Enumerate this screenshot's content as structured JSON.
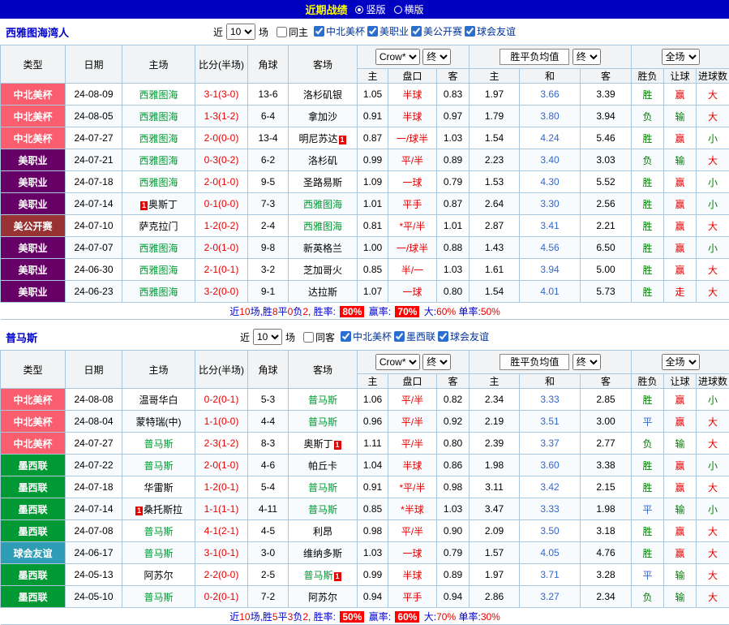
{
  "topbar": {
    "title": "近期战绩",
    "options": [
      {
        "label": "竖版",
        "selected": true
      },
      {
        "label": "横版",
        "selected": false
      }
    ]
  },
  "colors": {
    "topbar_bg": "#0101c1",
    "title_yellow": "#ffff00",
    "team_blue": "#0000cc",
    "green_team": "#009933",
    "score_red": "#e60000",
    "avg_draw_blue": "#3366cc",
    "type_leagues_cup": "#f95d6e",
    "type_mls": "#660066",
    "type_us_open": "#993333",
    "type_liga_mx": "#009933",
    "type_friendly": "#2f9db6"
  },
  "sections": [
    {
      "team": "西雅图海湾人",
      "filter": {
        "near": "近",
        "count": "10",
        "games": "场",
        "same": "同主",
        "leagues": [
          "中北美杯",
          "美职业",
          "美公开赛",
          "球会友谊"
        ]
      },
      "head": {
        "type": "类型",
        "date": "日期",
        "home": "主场",
        "score": "比分(半场)",
        "corner": "角球",
        "away": "客场",
        "odds_select": "Crow*",
        "fin1": "终",
        "avg": "胜平负均值",
        "fin2": "终",
        "scope": "全场",
        "sub": [
          "主",
          "盘口",
          "客",
          "主",
          "和",
          "客",
          "胜负",
          "让球",
          "进球数"
        ]
      },
      "rows": [
        {
          "type": "中北美杯",
          "tc": "cnc",
          "date": "24-08-09",
          "home": {
            "n": "西雅图海",
            "g": true,
            "b": ""
          },
          "score": "3-1(3-0)",
          "corner": "13-6",
          "away": {
            "n": "洛杉矶银",
            "g": false,
            "b": ""
          },
          "o1": "1.05",
          "pan": "半球",
          "o2": "0.83",
          "a1": "1.97",
          "a2": "3.66",
          "a3": "3.39",
          "r1": {
            "t": "胜",
            "c": "g"
          },
          "r2": {
            "t": "赢",
            "c": "r"
          },
          "r3": {
            "t": "大",
            "c": "r"
          }
        },
        {
          "type": "中北美杯",
          "tc": "cnc",
          "date": "24-08-05",
          "home": {
            "n": "西雅图海",
            "g": true,
            "b": ""
          },
          "score": "1-3(1-2)",
          "corner": "6-4",
          "away": {
            "n": "拿加沙",
            "g": false,
            "b": ""
          },
          "o1": "0.91",
          "pan": "半球",
          "o2": "0.97",
          "a1": "1.79",
          "a2": "3.80",
          "a3": "3.94",
          "r1": {
            "t": "负",
            "c": "g"
          },
          "r2": {
            "t": "输",
            "c": "g"
          },
          "r3": {
            "t": "大",
            "c": "r"
          }
        },
        {
          "type": "中北美杯",
          "tc": "cnc",
          "date": "24-07-27",
          "home": {
            "n": "西雅图海",
            "g": true,
            "b": ""
          },
          "score": "2-0(0-0)",
          "corner": "13-4",
          "away": {
            "n": "明尼苏达",
            "g": false,
            "b": "after"
          },
          "o1": "0.87",
          "pan": "一/球半",
          "o2": "1.03",
          "a1": "1.54",
          "a2": "4.24",
          "a3": "5.46",
          "r1": {
            "t": "胜",
            "c": "g"
          },
          "r2": {
            "t": "赢",
            "c": "r"
          },
          "r3": {
            "t": "小",
            "c": "g"
          }
        },
        {
          "type": "美职业",
          "tc": "mls",
          "date": "24-07-21",
          "home": {
            "n": "西雅图海",
            "g": true,
            "b": ""
          },
          "score": "0-3(0-2)",
          "corner": "6-2",
          "away": {
            "n": "洛杉矶",
            "g": false,
            "b": ""
          },
          "o1": "0.99",
          "pan": "平/半",
          "o2": "0.89",
          "a1": "2.23",
          "a2": "3.40",
          "a3": "3.03",
          "r1": {
            "t": "负",
            "c": "g"
          },
          "r2": {
            "t": "输",
            "c": "g"
          },
          "r3": {
            "t": "大",
            "c": "r"
          }
        },
        {
          "type": "美职业",
          "tc": "mls",
          "date": "24-07-18",
          "home": {
            "n": "西雅图海",
            "g": true,
            "b": ""
          },
          "score": "2-0(1-0)",
          "corner": "9-5",
          "away": {
            "n": "圣路易斯",
            "g": false,
            "b": ""
          },
          "o1": "1.09",
          "pan": "一球",
          "o2": "0.79",
          "a1": "1.53",
          "a2": "4.30",
          "a3": "5.52",
          "r1": {
            "t": "胜",
            "c": "g"
          },
          "r2": {
            "t": "赢",
            "c": "r"
          },
          "r3": {
            "t": "小",
            "c": "g"
          }
        },
        {
          "type": "美职业",
          "tc": "mls",
          "date": "24-07-14",
          "home": {
            "n": "奥斯丁",
            "g": false,
            "b": "before"
          },
          "score": "0-1(0-0)",
          "corner": "7-3",
          "away": {
            "n": "西雅图海",
            "g": true,
            "b": ""
          },
          "o1": "1.01",
          "pan": "平手",
          "o2": "0.87",
          "a1": "2.64",
          "a2": "3.30",
          "a3": "2.56",
          "r1": {
            "t": "胜",
            "c": "g"
          },
          "r2": {
            "t": "赢",
            "c": "r"
          },
          "r3": {
            "t": "小",
            "c": "g"
          }
        },
        {
          "type": "美公开赛",
          "tc": "open",
          "date": "24-07-10",
          "home": {
            "n": "萨克拉门",
            "g": false,
            "b": ""
          },
          "score": "1-2(0-2)",
          "corner": "2-4",
          "away": {
            "n": "西雅图海",
            "g": true,
            "b": ""
          },
          "o1": "0.81",
          "pan": "*平/半",
          "o2": "1.01",
          "a1": "2.87",
          "a2": "3.41",
          "a3": "2.21",
          "r1": {
            "t": "胜",
            "c": "g"
          },
          "r2": {
            "t": "赢",
            "c": "r"
          },
          "r3": {
            "t": "大",
            "c": "r"
          }
        },
        {
          "type": "美职业",
          "tc": "mls",
          "date": "24-07-07",
          "home": {
            "n": "西雅图海",
            "g": true,
            "b": ""
          },
          "score": "2-0(1-0)",
          "corner": "9-8",
          "away": {
            "n": "新英格兰",
            "g": false,
            "b": ""
          },
          "o1": "1.00",
          "pan": "一/球半",
          "o2": "0.88",
          "a1": "1.43",
          "a2": "4.56",
          "a3": "6.50",
          "r1": {
            "t": "胜",
            "c": "g"
          },
          "r2": {
            "t": "赢",
            "c": "r"
          },
          "r3": {
            "t": "小",
            "c": "g"
          }
        },
        {
          "type": "美职业",
          "tc": "mls",
          "date": "24-06-30",
          "home": {
            "n": "西雅图海",
            "g": true,
            "b": ""
          },
          "score": "2-1(0-1)",
          "corner": "3-2",
          "away": {
            "n": "芝加哥火",
            "g": false,
            "b": ""
          },
          "o1": "0.85",
          "pan": "半/一",
          "o2": "1.03",
          "a1": "1.61",
          "a2": "3.94",
          "a3": "5.00",
          "r1": {
            "t": "胜",
            "c": "g"
          },
          "r2": {
            "t": "赢",
            "c": "r"
          },
          "r3": {
            "t": "大",
            "c": "r"
          }
        },
        {
          "type": "美职业",
          "tc": "mls",
          "date": "24-06-23",
          "home": {
            "n": "西雅图海",
            "g": true,
            "b": ""
          },
          "score": "3-2(0-0)",
          "corner": "9-1",
          "away": {
            "n": "达拉斯",
            "g": false,
            "b": ""
          },
          "o1": "1.07",
          "pan": "一球",
          "o2": "0.80",
          "a1": "1.54",
          "a2": "4.01",
          "a3": "5.73",
          "r1": {
            "t": "胜",
            "c": "g"
          },
          "r2": {
            "t": "走",
            "c": "r"
          },
          "r3": {
            "t": "大",
            "c": "r"
          }
        }
      ],
      "footer": {
        "parts": [
          {
            "t": "近",
            "c": "fb"
          },
          {
            "t": "10",
            "c": "fr"
          },
          {
            "t": "场,胜",
            "c": "fb"
          },
          {
            "t": "8",
            "c": "fr"
          },
          {
            "t": "平",
            "c": "fb"
          },
          {
            "t": "0",
            "c": "fr"
          },
          {
            "t": "负",
            "c": "fb"
          },
          {
            "t": "2",
            "c": "fr"
          },
          {
            "t": ", 胜率: ",
            "c": "fb"
          },
          {
            "t": "80%",
            "c": "pct"
          },
          {
            "t": " 赢率: ",
            "c": "fb"
          },
          {
            "t": "70%",
            "c": "pct"
          },
          {
            "t": " 大:",
            "c": "fb"
          },
          {
            "t": "60%",
            "c": "fr"
          },
          {
            "t": " 单率:",
            "c": "fb"
          },
          {
            "t": "50%",
            "c": "fr"
          }
        ]
      }
    },
    {
      "team": "普马斯",
      "filter": {
        "near": "近",
        "count": "10",
        "games": "场",
        "same": "同客",
        "leagues": [
          "中北美杯",
          "墨西联",
          "球会友谊"
        ]
      },
      "head": {
        "type": "类型",
        "date": "日期",
        "home": "主场",
        "score": "比分(半场)",
        "corner": "角球",
        "away": "客场",
        "odds_select": "Crow*",
        "fin1": "终",
        "avg": "胜平负均值",
        "fin2": "终",
        "scope": "全场",
        "sub": [
          "主",
          "盘口",
          "客",
          "主",
          "和",
          "客",
          "胜负",
          "让球",
          "进球数"
        ]
      },
      "rows": [
        {
          "type": "中北美杯",
          "tc": "cnc",
          "date": "24-08-08",
          "home": {
            "n": "温哥华白",
            "g": false,
            "b": ""
          },
          "score": "0-2(0-1)",
          "corner": "5-3",
          "away": {
            "n": "普马斯",
            "g": true,
            "b": ""
          },
          "o1": "1.06",
          "pan": "平/半",
          "o2": "0.82",
          "a1": "2.34",
          "a2": "3.33",
          "a3": "2.85",
          "r1": {
            "t": "胜",
            "c": "g"
          },
          "r2": {
            "t": "赢",
            "c": "r"
          },
          "r3": {
            "t": "小",
            "c": "g"
          }
        },
        {
          "type": "中北美杯",
          "tc": "cnc",
          "date": "24-08-04",
          "home": {
            "n": "蒙特瑞(中)",
            "g": false,
            "b": ""
          },
          "score": "1-1(0-0)",
          "corner": "4-4",
          "away": {
            "n": "普马斯",
            "g": true,
            "b": ""
          },
          "o1": "0.96",
          "pan": "平/半",
          "o2": "0.92",
          "a1": "2.19",
          "a2": "3.51",
          "a3": "3.00",
          "r1": {
            "t": "平",
            "c": "b"
          },
          "r2": {
            "t": "赢",
            "c": "r"
          },
          "r3": {
            "t": "大",
            "c": "r"
          }
        },
        {
          "type": "中北美杯",
          "tc": "cnc",
          "date": "24-07-27",
          "home": {
            "n": "普马斯",
            "g": true,
            "b": ""
          },
          "score": "2-3(1-2)",
          "corner": "8-3",
          "away": {
            "n": "奥斯丁",
            "g": false,
            "b": "after"
          },
          "o1": "1.11",
          "pan": "平/半",
          "o2": "0.80",
          "a1": "2.39",
          "a2": "3.37",
          "a3": "2.77",
          "r1": {
            "t": "负",
            "c": "g"
          },
          "r2": {
            "t": "输",
            "c": "g"
          },
          "r3": {
            "t": "大",
            "c": "r"
          }
        },
        {
          "type": "墨西联",
          "tc": "mex",
          "date": "24-07-22",
          "home": {
            "n": "普马斯",
            "g": true,
            "b": ""
          },
          "score": "2-0(1-0)",
          "corner": "4-6",
          "away": {
            "n": "帕丘卡",
            "g": false,
            "b": ""
          },
          "o1": "1.04",
          "pan": "半球",
          "o2": "0.86",
          "a1": "1.98",
          "a2": "3.60",
          "a3": "3.38",
          "r1": {
            "t": "胜",
            "c": "g"
          },
          "r2": {
            "t": "赢",
            "c": "r"
          },
          "r3": {
            "t": "小",
            "c": "g"
          }
        },
        {
          "type": "墨西联",
          "tc": "mex",
          "date": "24-07-18",
          "home": {
            "n": "华雷斯",
            "g": false,
            "b": ""
          },
          "score": "1-2(0-1)",
          "corner": "5-4",
          "away": {
            "n": "普马斯",
            "g": true,
            "b": ""
          },
          "o1": "0.91",
          "pan": "*平/半",
          "o2": "0.98",
          "a1": "3.11",
          "a2": "3.42",
          "a3": "2.15",
          "r1": {
            "t": "胜",
            "c": "g"
          },
          "r2": {
            "t": "赢",
            "c": "r"
          },
          "r3": {
            "t": "大",
            "c": "r"
          }
        },
        {
          "type": "墨西联",
          "tc": "mex",
          "date": "24-07-14",
          "home": {
            "n": "桑托斯拉",
            "g": false,
            "b": "before"
          },
          "score": "1-1(1-1)",
          "corner": "4-11",
          "away": {
            "n": "普马斯",
            "g": true,
            "b": ""
          },
          "o1": "0.85",
          "pan": "*半球",
          "o2": "1.03",
          "a1": "3.47",
          "a2": "3.33",
          "a3": "1.98",
          "r1": {
            "t": "平",
            "c": "b"
          },
          "r2": {
            "t": "输",
            "c": "g"
          },
          "r3": {
            "t": "小",
            "c": "g"
          }
        },
        {
          "type": "墨西联",
          "tc": "mex",
          "date": "24-07-08",
          "home": {
            "n": "普马斯",
            "g": true,
            "b": ""
          },
          "score": "4-1(2-1)",
          "corner": "4-5",
          "away": {
            "n": "利昂",
            "g": false,
            "b": ""
          },
          "o1": "0.98",
          "pan": "平/半",
          "o2": "0.90",
          "a1": "2.09",
          "a2": "3.50",
          "a3": "3.18",
          "r1": {
            "t": "胜",
            "c": "g"
          },
          "r2": {
            "t": "赢",
            "c": "r"
          },
          "r3": {
            "t": "大",
            "c": "r"
          }
        },
        {
          "type": "球会友谊",
          "tc": "fr",
          "date": "24-06-17",
          "home": {
            "n": "普马斯",
            "g": true,
            "b": ""
          },
          "score": "3-1(0-1)",
          "corner": "3-0",
          "away": {
            "n": "维纳多斯",
            "g": false,
            "b": ""
          },
          "o1": "1.03",
          "pan": "一球",
          "o2": "0.79",
          "a1": "1.57",
          "a2": "4.05",
          "a3": "4.76",
          "r1": {
            "t": "胜",
            "c": "g"
          },
          "r2": {
            "t": "赢",
            "c": "r"
          },
          "r3": {
            "t": "大",
            "c": "r"
          }
        },
        {
          "type": "墨西联",
          "tc": "mex",
          "date": "24-05-13",
          "home": {
            "n": "阿苏尔",
            "g": false,
            "b": ""
          },
          "score": "2-2(0-0)",
          "corner": "2-5",
          "away": {
            "n": "普马斯",
            "g": true,
            "b": "after"
          },
          "o1": "0.99",
          "pan": "半球",
          "o2": "0.89",
          "a1": "1.97",
          "a2": "3.71",
          "a3": "3.28",
          "r1": {
            "t": "平",
            "c": "b"
          },
          "r2": {
            "t": "输",
            "c": "g"
          },
          "r3": {
            "t": "大",
            "c": "r"
          }
        },
        {
          "type": "墨西联",
          "tc": "mex",
          "date": "24-05-10",
          "home": {
            "n": "普马斯",
            "g": true,
            "b": ""
          },
          "score": "0-2(0-1)",
          "corner": "7-2",
          "away": {
            "n": "阿苏尔",
            "g": false,
            "b": ""
          },
          "o1": "0.94",
          "pan": "平手",
          "o2": "0.94",
          "a1": "2.86",
          "a2": "3.27",
          "a3": "2.34",
          "r1": {
            "t": "负",
            "c": "g"
          },
          "r2": {
            "t": "输",
            "c": "g"
          },
          "r3": {
            "t": "大",
            "c": "r"
          }
        }
      ],
      "footer": {
        "parts": [
          {
            "t": "近",
            "c": "fb"
          },
          {
            "t": "10",
            "c": "fr"
          },
          {
            "t": "场,胜",
            "c": "fb"
          },
          {
            "t": "5",
            "c": "fr"
          },
          {
            "t": "平",
            "c": "fb"
          },
          {
            "t": "3",
            "c": "fr"
          },
          {
            "t": "负",
            "c": "fb"
          },
          {
            "t": "2",
            "c": "fr"
          },
          {
            "t": ", 胜率: ",
            "c": "fb"
          },
          {
            "t": "50%",
            "c": "pct"
          },
          {
            "t": " 赢率: ",
            "c": "fb"
          },
          {
            "t": "60%",
            "c": "pct"
          },
          {
            "t": " 大:",
            "c": "fb"
          },
          {
            "t": "70%",
            "c": "fr"
          },
          {
            "t": " 单率:",
            "c": "fb"
          },
          {
            "t": "30%",
            "c": "fr"
          }
        ]
      }
    }
  ]
}
